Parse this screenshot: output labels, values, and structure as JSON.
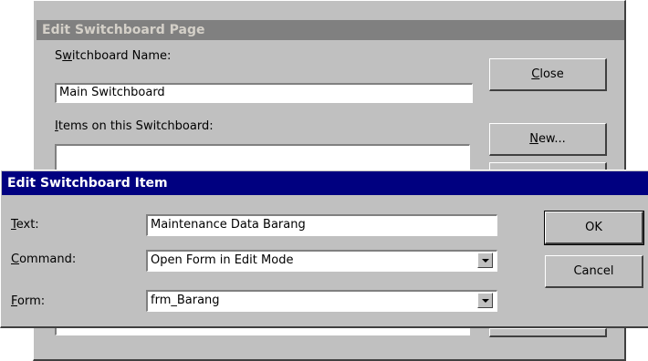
{
  "outer_dialog": {
    "title": "Edit Switchboard Page",
    "name_label_pre": "S",
    "name_label_key": "w",
    "name_label_post": "itchboard Name:",
    "name_value": "Main Switchboard",
    "items_label_key": "I",
    "items_label_post": "tems on this Switchboard:",
    "close_key": "C",
    "close_rest": "lose",
    "new_key": "N",
    "new_rest": "ew..."
  },
  "inner_dialog": {
    "title": "Edit Switchboard Item",
    "text_key": "T",
    "text_rest": "ext:",
    "text_value": "Maintenance Data Barang",
    "command_key": "C",
    "command_rest": "ommand:",
    "command_value": "Open Form in Edit Mode",
    "form_key": "F",
    "form_rest": "orm:",
    "form_value": "frm_Barang",
    "ok_label": "OK",
    "cancel_label": "Cancel"
  },
  "colors": {
    "active_title": "#000080",
    "inactive_title": "#808080",
    "face": "#c0c0c0"
  },
  "icons": [
    "dropdown-arrow-icon"
  ]
}
